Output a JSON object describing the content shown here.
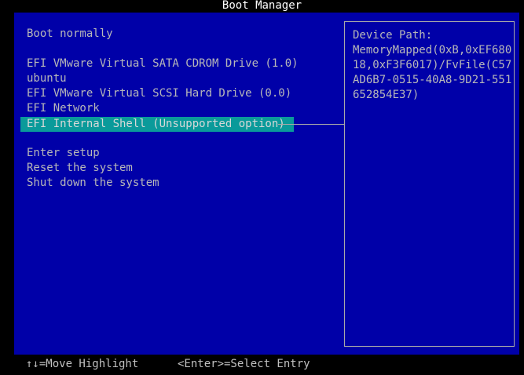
{
  "window": {
    "title": "Boot Manager"
  },
  "menu": {
    "items": [
      {
        "label": "Boot normally",
        "selected": false
      },
      {
        "label": "EFI VMware Virtual SATA CDROM Drive (1.0)",
        "selected": false
      },
      {
        "label": "ubuntu",
        "selected": false
      },
      {
        "label": "EFI VMware Virtual SCSI Hard Drive (0.0)",
        "selected": false
      },
      {
        "label": "EFI Network",
        "selected": false
      },
      {
        "label": "EFI Internal Shell (Unsupported option)",
        "selected": true
      },
      {
        "label": "Enter setup",
        "selected": false
      },
      {
        "label": "Reset the system",
        "selected": false
      },
      {
        "label": "Shut down the system",
        "selected": false
      }
    ]
  },
  "info_panel": {
    "heading": "Device Path:",
    "lines": [
      "MemoryMapped(0xB,0xEF680",
      "18,0xF3F6017)/FvFile(C57",
      "AD6B7-0515-40A8-9D21-551",
      "652854E37)"
    ]
  },
  "footer": {
    "move_hint": "↑↓=Move Highlight",
    "select_hint": "<Enter>=Select Entry"
  },
  "colors": {
    "background": "#0000a8",
    "highlight": "#0a9a9a",
    "text": "#b8b8b8"
  }
}
